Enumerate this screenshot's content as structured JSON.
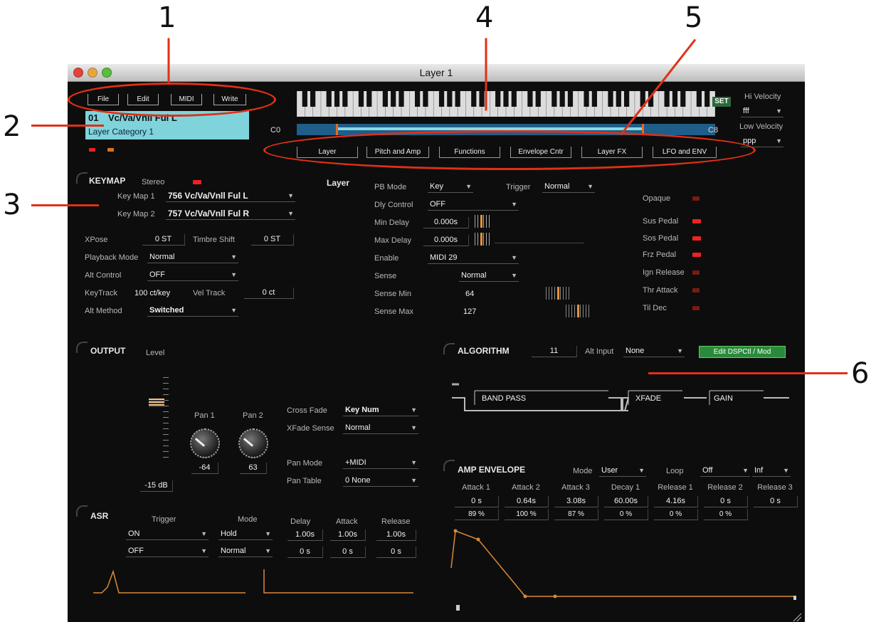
{
  "callouts": [
    "1",
    "2",
    "3",
    "4",
    "5",
    "6"
  ],
  "window": {
    "title": "Layer 1"
  },
  "menu": [
    "File",
    "Edit",
    "MIDI",
    "Write"
  ],
  "program": {
    "number": "01",
    "name": "Vc/Va/Vnll Ful L",
    "category": "Layer Category 1"
  },
  "keyboard": {
    "low": "C0",
    "high": "C8",
    "set_label": "SET"
  },
  "velocity": {
    "hi_label": "Hi Velocity",
    "hi_value": "fff",
    "low_label": "Low Velocity",
    "low_value": "ppp"
  },
  "tabs": [
    "Layer",
    "Pitch and Amp",
    "Functions",
    "Envelope Cntr",
    "Layer FX",
    "LFO and ENV"
  ],
  "keymap": {
    "header": "KEYMAP",
    "stereo_label": "Stereo",
    "keymap1_label": "Key Map 1",
    "keymap1_value": "756 Vc/Va/Vnll Ful L",
    "keymap2_label": "Key Map 2",
    "keymap2_value": "757 Vc/Va/Vnll Ful R",
    "xpose_label": "XPose",
    "xpose_value": "0 ST",
    "timbre_label": "Timbre Shift",
    "timbre_value": "0 ST",
    "playback_label": "Playback Mode",
    "playback_value": "Normal",
    "altcontrol_label": "Alt Control",
    "altcontrol_value": "OFF",
    "keytrack_label": "KeyTrack",
    "keytrack_value": "100 ct/key",
    "veltrack_label": "Vel Track",
    "veltrack_value": "0 ct",
    "altmethod_label": "Alt Method",
    "altmethod_value": "Switched"
  },
  "layer": {
    "header": "Layer",
    "pbmode_label": "PB Mode",
    "pbmode_value": "Key",
    "trigger_label": "Trigger",
    "trigger_value": "Normal",
    "dlycontrol_label": "Dly Control",
    "dlycontrol_value": "OFF",
    "mindelay_label": "Min Delay",
    "mindelay_value": "0.000s",
    "maxdelay_label": "Max Delay",
    "maxdelay_value": "0.000s",
    "enable_label": "Enable",
    "enable_value": "MIDI 29",
    "sense_label": "Sense",
    "sense_value": "Normal",
    "sensemin_label": "Sense Min",
    "sensemin_value": "64",
    "sensemax_label": "Sense Max",
    "sensemax_value": "127",
    "toggles": [
      "Opaque",
      "Sus Pedal",
      "Sos Pedal",
      "Frz Pedal",
      "Ign Release",
      "Thr Attack",
      "Til Dec"
    ]
  },
  "output": {
    "header": "OUTPUT",
    "level_label": "Level",
    "level_value": "-15 dB",
    "pan1_label": "Pan 1",
    "pan1_value": "-64",
    "pan2_label": "Pan 2",
    "pan2_value": "63",
    "crossfade_label": "Cross Fade",
    "crossfade_value": "Key Num",
    "xfadesense_label": "XFade Sense",
    "xfadesense_value": "Normal",
    "panmode_label": "Pan Mode",
    "panmode_value": "+MIDI",
    "pantable_label": "Pan Table",
    "pantable_value": "0 None"
  },
  "algorithm": {
    "header": "ALGORITHM",
    "number": "11",
    "altinput_label": "Alt Input",
    "altinput_value": "None",
    "edit_button": "Edit DSPCtl / Mod",
    "blocks": [
      "BAND PASS",
      "XFADE",
      "GAIN"
    ]
  },
  "amp_envelope": {
    "header": "AMP ENVELOPE",
    "mode_label": "Mode",
    "mode_value": "User",
    "loop_label": "Loop",
    "loop_value": "Off",
    "loop_count": "Inf",
    "columns": [
      "Attack 1",
      "Attack 2",
      "Attack 3",
      "Decay 1",
      "Release 1",
      "Release 2",
      "Release 3"
    ],
    "times": [
      "0 s",
      "0.64s",
      "3.08s",
      "60.00s",
      "4.16s",
      "0 s",
      "0 s"
    ],
    "levels": [
      "89 %",
      "100 %",
      "87 %",
      "0 %",
      "0 %",
      "0 %"
    ]
  },
  "asr": {
    "header": "ASR",
    "trigger_label": "Trigger",
    "mode_label": "Mode",
    "delay_label": "Delay",
    "attack_label": "Attack",
    "release_label": "Release",
    "rows": [
      {
        "trigger": "ON",
        "mode": "Hold",
        "delay": "1.00s",
        "attack": "1.00s",
        "release": "1.00s"
      },
      {
        "trigger": "OFF",
        "mode": "Normal",
        "delay": "0 s",
        "attack": "0 s",
        "release": "0 s"
      }
    ]
  },
  "colors": {
    "accent_red": "#e03016",
    "display_cyan": "#7fd4dc",
    "edit_green": "#2a8a3c",
    "envelope_line": "#d98a3a"
  }
}
